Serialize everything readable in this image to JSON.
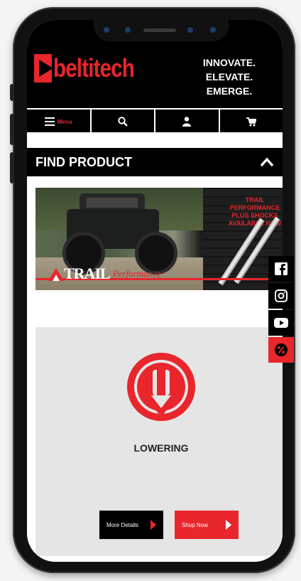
{
  "brand": {
    "logo_text": "beltitech",
    "tagline": [
      "INNOVATE.",
      "ELEVATE.",
      "EMERGE."
    ]
  },
  "nav": {
    "menu_label": "Menu",
    "items": [
      "menu-icon",
      "search-icon",
      "user-icon",
      "cart-icon"
    ]
  },
  "find_product": {
    "title": "FIND PRODUCT"
  },
  "banner": {
    "headline": "TRAIL PERFORMANCE PLUS SHOCKS AVAILABLE NOW",
    "logo_word": "TRAIL",
    "logo_script": "Performance"
  },
  "social": [
    "facebook-icon",
    "instagram-icon",
    "youtube-icon",
    "percent-icon"
  ],
  "product": {
    "name": "LOWERING",
    "more_details_label": "More Details",
    "shop_now_label": "Shop Now"
  },
  "colors": {
    "brand_red": "#e8262b",
    "black": "#000000",
    "card_gray": "#e5e5e5"
  }
}
